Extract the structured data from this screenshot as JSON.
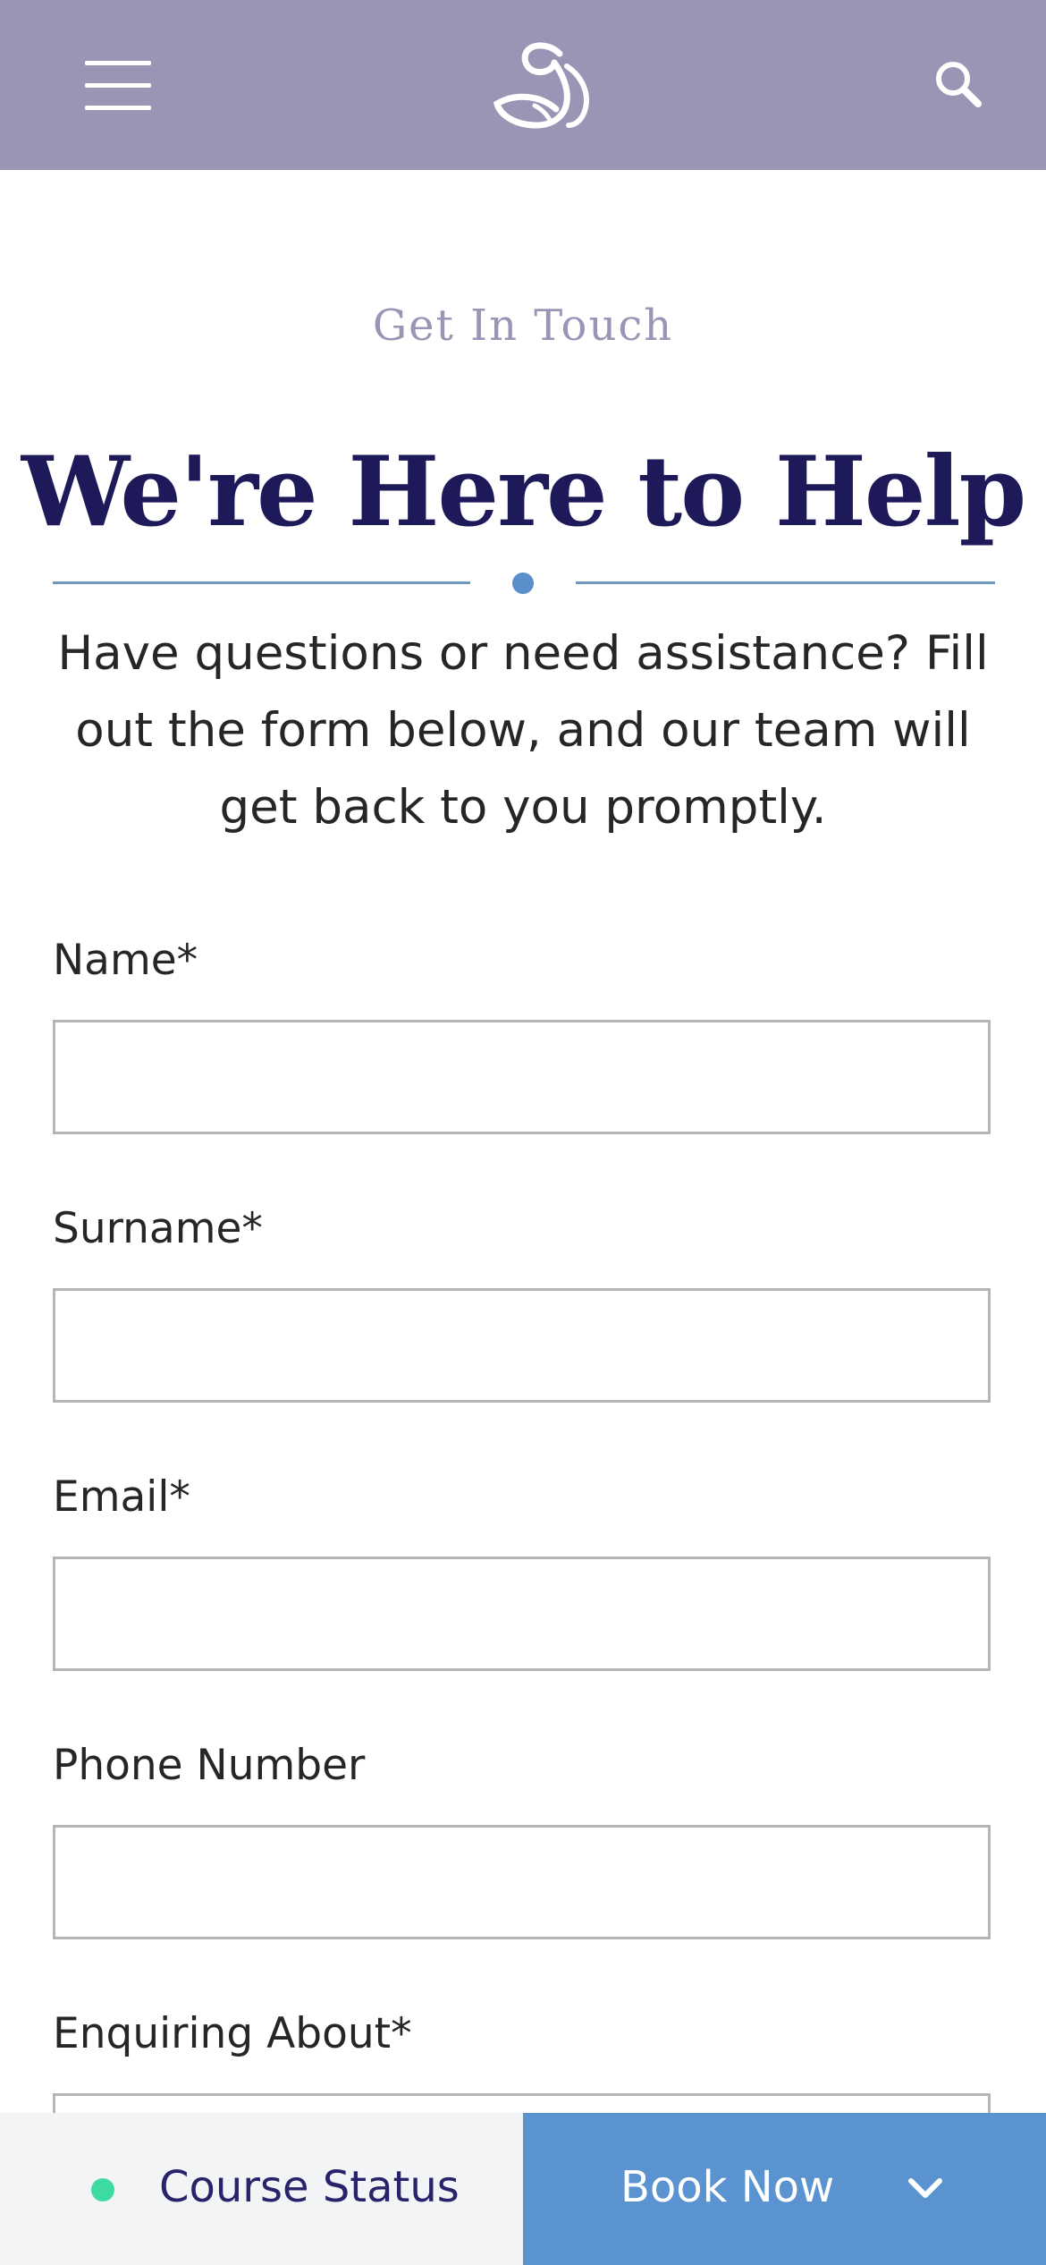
{
  "header": {
    "menu_icon": "hamburger-menu-icon",
    "logo": "swan-logo",
    "search_icon": "search-icon",
    "background_color": "#9996b5"
  },
  "hero": {
    "eyebrow": "Get In Touch",
    "title": "We're Here to Help",
    "intro": "Have questions or need assistance? Fill out the form below, and our team will get back to you promptly."
  },
  "form": {
    "fields": [
      {
        "label": "Name*",
        "value": ""
      },
      {
        "label": "Surname*",
        "value": ""
      },
      {
        "label": "Email*",
        "value": ""
      },
      {
        "label": "Phone Number",
        "value": ""
      },
      {
        "label": "Enquiring About*",
        "value": ""
      }
    ]
  },
  "bottom_bar": {
    "course_status_label": "Course Status",
    "status_color": "#3ddba1",
    "book_now_label": "Book Now",
    "book_now_icon": "chevron-down-icon"
  },
  "colors": {
    "title": "#1e1a5a",
    "accent": "#5b93d1",
    "eyebrow": "#9996b5"
  }
}
